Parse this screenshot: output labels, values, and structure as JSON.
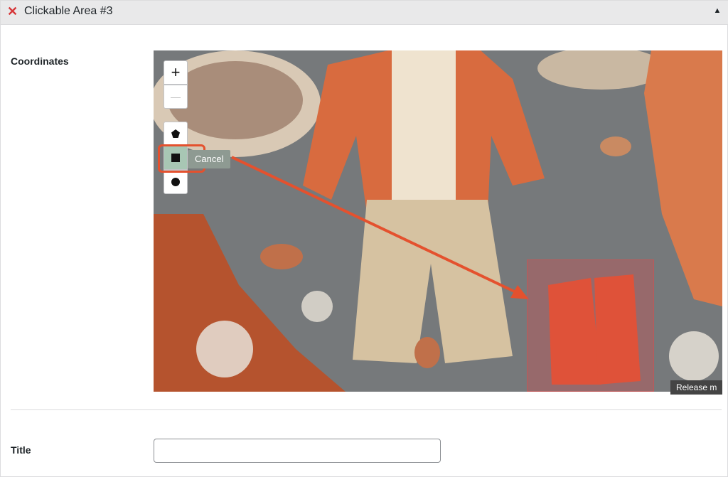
{
  "panel": {
    "title": "Clickable Area #3",
    "remove_icon": "close-icon",
    "collapse_icon": "caret-up-icon"
  },
  "fields": {
    "coordinates_label": "Coordinates",
    "title_label": "Title",
    "title_value": ""
  },
  "editor": {
    "toolbar": {
      "zoom_in_label": "+",
      "zoom_out_label": "—",
      "polygon_icon": "pentagon-icon",
      "rectangle_icon": "square-icon",
      "circle_icon": "circle-icon"
    },
    "cancel_label": "Cancel",
    "release_hint": "Release m"
  },
  "colors": {
    "accent_red": "#e4512e",
    "area_fill": "#d64e4e",
    "remove_red": "#d63638"
  }
}
